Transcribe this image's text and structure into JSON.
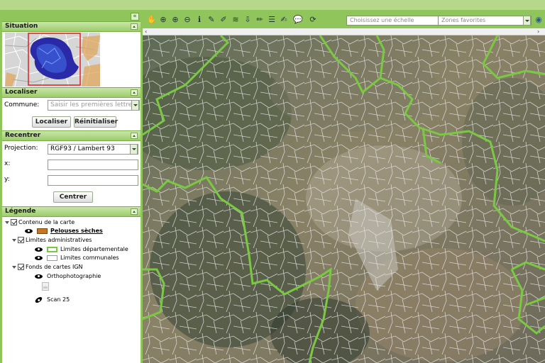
{
  "left_panel": {
    "collapse_label": "«",
    "situation": {
      "title": "Situation"
    },
    "localiser": {
      "title": "Localiser",
      "commune_label": "Commune:",
      "commune_placeholder": "Saisir les premières lettres",
      "localiser_button": "Localiser",
      "reinitialiser_button": "Réinitialiser"
    },
    "recentrer": {
      "title": "Recentrer",
      "projection_label": "Projection:",
      "projection_value": "RGF93 / Lambert 93",
      "x_label": "x:",
      "y_label": "y:",
      "x_value": "",
      "y_value": "",
      "centrer_button": "Centrer"
    },
    "legende": {
      "title": "Légende",
      "groups": [
        {
          "label": "Contenu de la carte",
          "items": [
            {
              "label": "Pelouses sèches",
              "swatch_color": "#c9761e",
              "icon": "eye-icon"
            }
          ]
        },
        {
          "label": "Limites administratives",
          "items": [
            {
              "label": "Limites départementale",
              "swatch_color": "#7ac943",
              "icon": "eye-icon"
            },
            {
              "label": "Limites communales",
              "swatch_color": "#ffffff",
              "icon": "eye-icon"
            }
          ]
        },
        {
          "label": "Fonds de cartes IGN",
          "items": [
            {
              "label": "Orthophotographie",
              "icon": "eye-icon"
            },
            {
              "label": "Scan 25",
              "icon": "eye-off-icon"
            }
          ]
        }
      ]
    }
  },
  "toolbar": {
    "tools": [
      "pan-hand-icon",
      "zoom-box-icon",
      "zoom-in-icon",
      "zoom-out-icon",
      "info-icon",
      "measure-icon",
      "draw-icon",
      "layers-icon",
      "export-icon",
      "edit-icon",
      "list-icon",
      "pencil-icon",
      "comment-icon",
      "refresh-icon"
    ],
    "scale_placeholder": "Choisissez une échelle",
    "favorites_placeholder": "Zones favorites"
  },
  "colors": {
    "frame_green": "#8fc55a",
    "department_boundary": "#7ac943",
    "commune_boundary": "#d8d8d8"
  }
}
